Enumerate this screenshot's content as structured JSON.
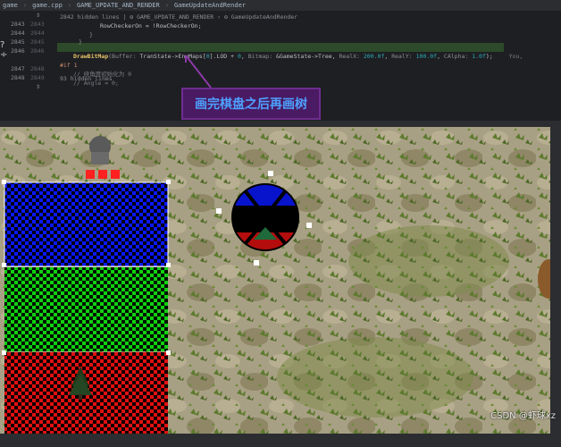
{
  "breadcrumb": {
    "items": [
      "game",
      "game.cpp",
      "GAME_UPDATE_AND_RENDER",
      "GameUpdateAndRender"
    ],
    "summary_hidden": "2842 hidden lines",
    "summary_path": [
      "GAME_UPDATE_AND_RENDER",
      "GameUpdateAndRender"
    ]
  },
  "code": {
    "lines": [
      {
        "n1": "",
        "n2": "",
        "text": "RowCheckerOn = !RowCheckerOn;"
      },
      {
        "n1": "2843",
        "n2": "2843",
        "text": "}"
      },
      {
        "n1": "2844",
        "n2": "2844",
        "text": "}"
      },
      {
        "n1": "2845",
        "n2": "2845",
        "text": ""
      },
      {
        "n1": "2846",
        "n2": "2846",
        "text": "DrawBitMap(Buffer: TranState->EnvMaps[0].LOD + 0, Bitmap: &GameState->Tree, RealX: 200.0f, RealY: 100.0f, CAlpha: 1.0f);"
      },
      {
        "n1": "",
        "n2": "",
        "text": "#if 1"
      },
      {
        "n1": "2847",
        "n2": "2848",
        "text": "// 绕角度初始化为 0"
      },
      {
        "n1": "2848",
        "n2": "2849",
        "text": "// Angle = 0;"
      }
    ],
    "hidden_top": "",
    "hidden_bottom": "93 hidden lines",
    "highlight_suffix": "You,"
  },
  "callout": {
    "text": "画完棋盘之后再画树"
  },
  "side_marks": [
    "?",
    "÷"
  ],
  "watermark": "CSDN @虾球xz",
  "colors": {
    "blue": "#0a18ff",
    "green": "#10d010",
    "red": "#e01010",
    "highlight": "#2d4a2a",
    "callout_bg": "#4a1a63",
    "callout_text": "#4ea0ff"
  }
}
